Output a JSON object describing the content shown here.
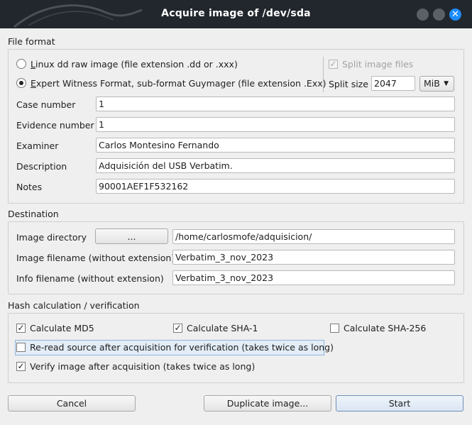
{
  "window": {
    "title": "Acquire image of /dev/sda"
  },
  "file_format": {
    "section_title": "File format",
    "option_dd_accel": "L",
    "option_dd_rest": "inux dd raw image (file extension .dd or .xxx)",
    "option_ewf_accel": "E",
    "option_ewf_rest": "xpert Witness Format, sub-format Guymager (file extension .Exx)",
    "selected": "ewf",
    "split_files_label": "Split image files",
    "split_files_checked": true,
    "split_size_label": "Split size",
    "split_size_value": "2047",
    "split_unit": "MiB",
    "case_number_label": "Case number",
    "case_number_value": "1",
    "evidence_number_label": "Evidence number",
    "evidence_number_value": "1",
    "examiner_label": "Examiner",
    "examiner_value": "Carlos Montesino Fernando",
    "description_label": "Description",
    "description_value": "Adquisición del USB Verbatim.",
    "notes_label": "Notes",
    "notes_value": "90001AEF1F532162"
  },
  "destination": {
    "section_title": "Destination",
    "image_directory_label": "Image directory",
    "browse_label": "...",
    "image_directory_value": "/home/carlosmofe/adquisicion/",
    "image_filename_label": "Image filename (without extension)",
    "image_filename_value": "Verbatim_3_nov_2023",
    "info_filename_label": "Info filename (without extension)",
    "info_filename_value": "Verbatim_3_nov_2023"
  },
  "hash": {
    "section_title": "Hash calculation / verification",
    "md5_label": "Calculate MD5",
    "md5_checked": "✓",
    "sha1_label": "Calculate SHA-1",
    "sha1_checked": "✓",
    "sha256_label": "Calculate SHA-256",
    "sha256_checked": "",
    "reread_label": "Re-read source after acquisition for verification (takes twice as long)",
    "reread_checked": "",
    "verify_label": "Verify image after acquisition (takes twice as long)",
    "verify_checked": "✓"
  },
  "buttons": {
    "cancel": "Cancel",
    "duplicate": "Duplicate image...",
    "start": "Start"
  },
  "icons": {
    "minimize": "minimize-icon",
    "maximize": "maximize-icon",
    "close": "close-icon",
    "dropdown": "chevron-down-icon"
  }
}
